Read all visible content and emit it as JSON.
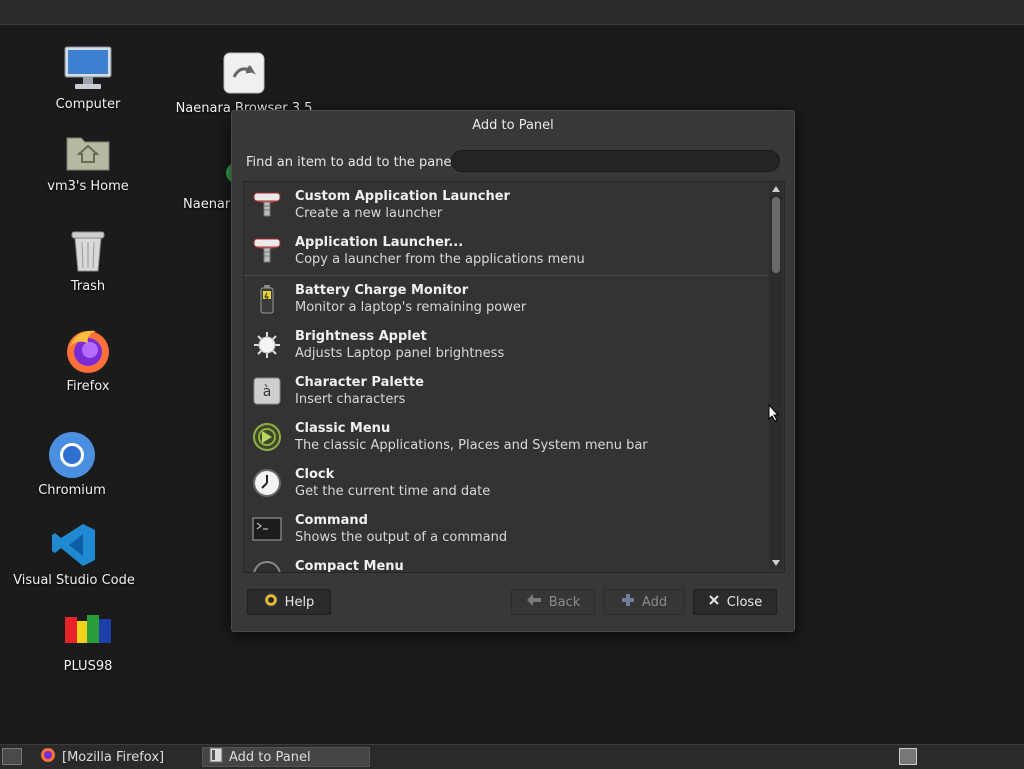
{
  "desktop": {
    "icons": [
      {
        "label": "Computer"
      },
      {
        "label": "vm3's Home"
      },
      {
        "label": "Trash"
      },
      {
        "label": "Firefox"
      },
      {
        "label": "Chromium"
      },
      {
        "label": "Visual Studio Code"
      },
      {
        "label": "PLUS98"
      },
      {
        "label": "Naenara Browser 3.5"
      },
      {
        "label": "Naenara"
      }
    ]
  },
  "dialog": {
    "title": "Add to Panel",
    "find_label": "Find an item to add to the panel:",
    "search": {
      "value": "",
      "placeholder": ""
    },
    "items": [
      {
        "name": "Custom Application Launcher",
        "desc": "Create a new launcher",
        "icon": "launcher-icon"
      },
      {
        "name": "Application Launcher...",
        "desc": "Copy a launcher from the applications menu",
        "icon": "launcher-icon"
      },
      {
        "name": "Battery Charge Monitor",
        "desc": "Monitor a laptop's remaining power",
        "icon": "battery-icon"
      },
      {
        "name": "Brightness Applet",
        "desc": "Adjusts Laptop panel brightness",
        "icon": "brightness-icon"
      },
      {
        "name": "Character Palette",
        "desc": "Insert characters",
        "icon": "character-icon"
      },
      {
        "name": "Classic Menu",
        "desc": "The classic Applications, Places and System menu bar",
        "icon": "menu-icon"
      },
      {
        "name": "Clock",
        "desc": "Get the current time and date",
        "icon": "clock-icon"
      },
      {
        "name": "Command",
        "desc": "Shows the output of a command",
        "icon": "terminal-icon"
      },
      {
        "name": "Compact Menu",
        "desc": "",
        "icon": "menu-icon"
      }
    ],
    "buttons": {
      "help": "Help",
      "back": "Back",
      "add": "Add",
      "close": "Close"
    }
  },
  "taskbar": {
    "tasks": [
      {
        "label": "[Mozilla Firefox]"
      },
      {
        "label": "Add to Panel"
      }
    ]
  },
  "colors": {
    "background": "#1b1b1b",
    "dialog": "#383838",
    "list": "#333333"
  }
}
